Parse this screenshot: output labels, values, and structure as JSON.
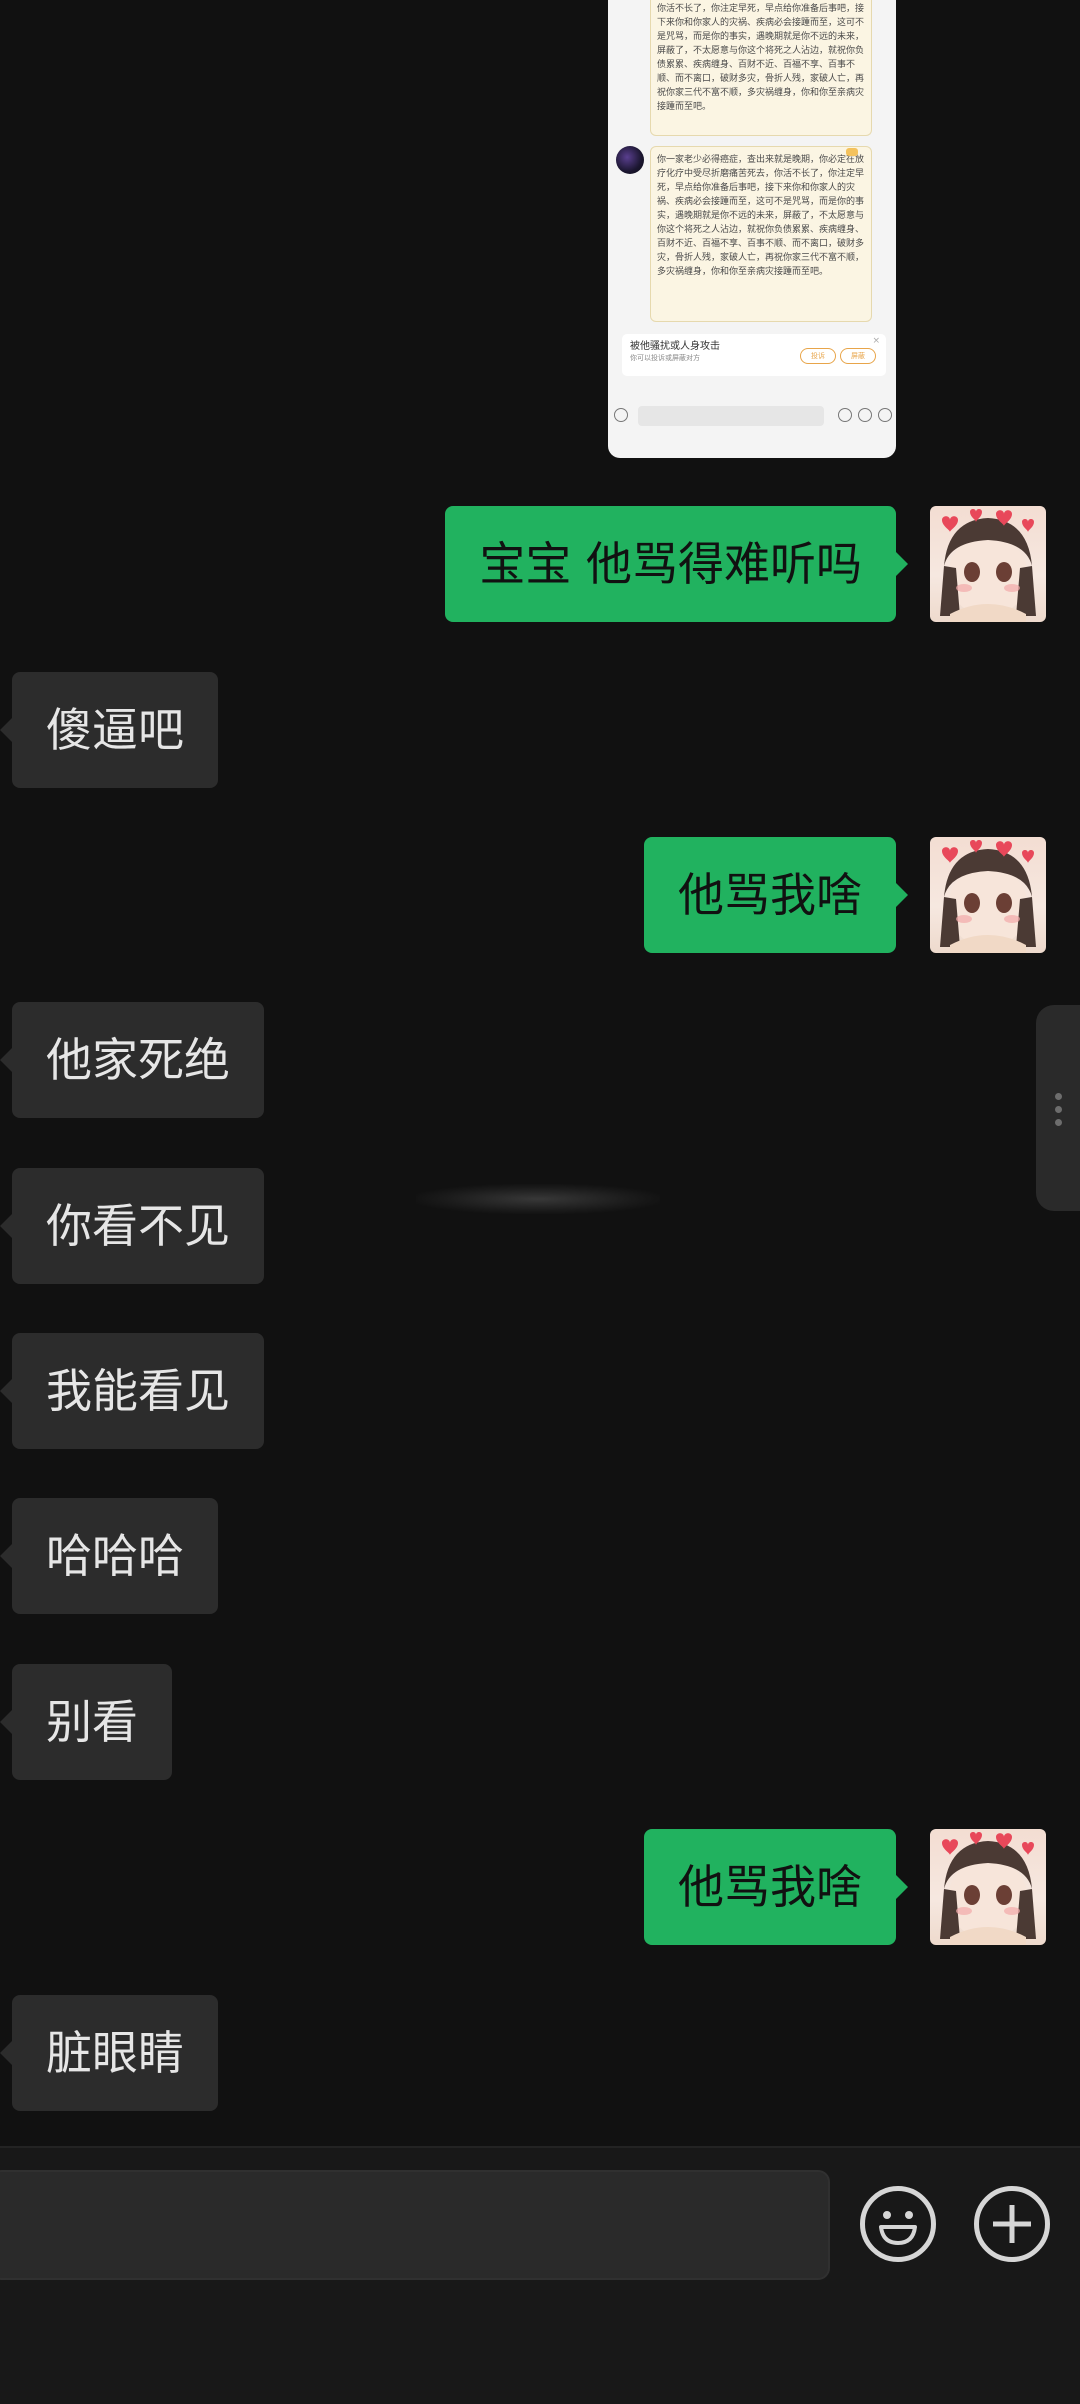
{
  "embedded_screenshot": {
    "top_message_text": "你活不长了，你注定早死，早点给你准备后事吧，接下来你和你家人的灾祸、疾病必会接踵而至，这可不是咒骂，而是你的事实，遇晚期就是你不远的未来，屏蔽了，不太愿意与你这个将死之人沾边，就祝你负债累累、疾病缠身、百财不近、百福不享、百事不顺、而不离口，破财多灾，骨折人残，家破人亡，再祝你家三代不富不顺，多灾祸缠身，你和你至亲病灾接踵而至吧。",
    "second_message_text": "你一家老少必得癌症，查出来就是晚期，你必定在放疗化疗中受尽折磨痛苦死去，你活不长了，你注定早死，早点给你准备后事吧，接下来你和你家人的灾祸、疾病必会接踵而至，这可不是咒骂，而是你的事实，遇晚期就是你不远的未来，屏蔽了，不太愿意与你这个将死之人沾边，就祝你负债累累、疾病缠身、百财不近、百福不享、百事不顺、而不离口，破财多灾，骨折人残，家破人亡，再祝你家三代不富不顺，多灾祸缠身，你和你至亲病灾接踵而至吧。",
    "warning_title": "被他骚扰或人身攻击",
    "warning_sub": "你可以投诉或屏蔽对方",
    "warning_btn_report": "投诉",
    "warning_btn_block": "屏蔽"
  },
  "messages": [
    {
      "side": "out",
      "text": "宝宝 他骂得难听吗"
    },
    {
      "side": "in",
      "text": "傻逼吧"
    },
    {
      "side": "out",
      "text": "他骂我啥"
    },
    {
      "side": "in",
      "text": "他家死绝"
    },
    {
      "side": "in",
      "text": "你看不见"
    },
    {
      "side": "in",
      "text": "我能看见"
    },
    {
      "side": "in",
      "text": "哈哈哈"
    },
    {
      "side": "in",
      "text": "别看"
    },
    {
      "side": "out",
      "text": "他骂我啥"
    },
    {
      "side": "in",
      "text": "脏眼睛"
    }
  ],
  "colors": {
    "background": "#111111",
    "incoming_bubble": "#2c2c2c",
    "outgoing_bubble": "#21b25f"
  },
  "icons": {
    "emoji": "smiley-icon",
    "more": "plus-circle-icon"
  }
}
